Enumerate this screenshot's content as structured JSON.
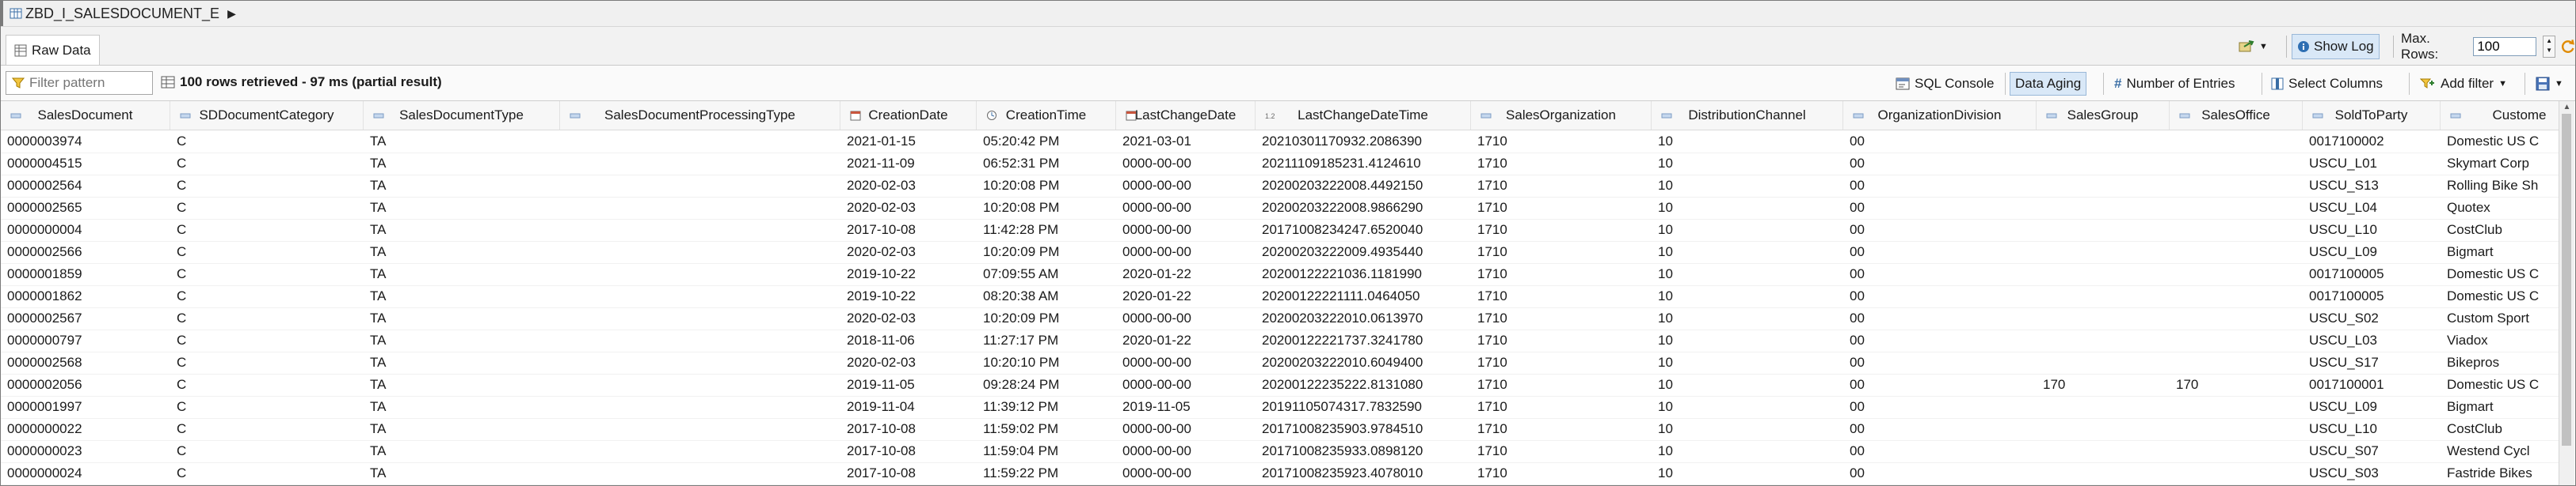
{
  "breadcrumb": {
    "label": "ZBD_I_SALESDOCUMENT_E"
  },
  "tabs": [
    {
      "label": "Raw Data"
    }
  ],
  "header_right": {
    "show_log_label": "Show Log",
    "max_rows_label": "Max. Rows:",
    "max_rows_value": "100"
  },
  "toolbar": {
    "filter_placeholder": "Filter pattern",
    "result_info": "100 rows retrieved - 97 ms (partial result)",
    "sql_console_label": "SQL Console",
    "data_aging_label": "Data Aging",
    "number_of_entries_label": "Number of Entries",
    "select_columns_label": "Select Columns",
    "add_filter_label": "Add filter"
  },
  "table": {
    "columns": [
      {
        "label": "SalesDocument",
        "type": "text"
      },
      {
        "label": "SDDocumentCategory",
        "type": "text"
      },
      {
        "label": "SalesDocumentType",
        "type": "text"
      },
      {
        "label": "SalesDocumentProcessingType",
        "type": "text"
      },
      {
        "label": "CreationDate",
        "type": "date"
      },
      {
        "label": "CreationTime",
        "type": "time"
      },
      {
        "label": "LastChangeDate",
        "type": "date"
      },
      {
        "label": "LastChangeDateTime",
        "type": "number"
      },
      {
        "label": "SalesOrganization",
        "type": "text"
      },
      {
        "label": "DistributionChannel",
        "type": "text"
      },
      {
        "label": "OrganizationDivision",
        "type": "text"
      },
      {
        "label": "SalesGroup",
        "type": "text"
      },
      {
        "label": "SalesOffice",
        "type": "text"
      },
      {
        "label": "SoldToParty",
        "type": "text"
      },
      {
        "label": "Custome",
        "type": "text"
      }
    ],
    "rows": [
      [
        "0000003974",
        "C",
        "TA",
        "",
        "2021-01-15",
        "05:20:42 PM",
        "2021-03-01",
        "20210301170932.2086390",
        "1710",
        "10",
        "00",
        "",
        "",
        "0017100002",
        "Domestic US C"
      ],
      [
        "0000004515",
        "C",
        "TA",
        "",
        "2021-11-09",
        "06:52:31 PM",
        "0000-00-00",
        "20211109185231.4124610",
        "1710",
        "10",
        "00",
        "",
        "",
        "USCU_L01",
        "Skymart Corp"
      ],
      [
        "0000002564",
        "C",
        "TA",
        "",
        "2020-02-03",
        "10:20:08 PM",
        "0000-00-00",
        "20200203222008.4492150",
        "1710",
        "10",
        "00",
        "",
        "",
        "USCU_S13",
        "Rolling Bike Sh"
      ],
      [
        "0000002565",
        "C",
        "TA",
        "",
        "2020-02-03",
        "10:20:08 PM",
        "0000-00-00",
        "20200203222008.9866290",
        "1710",
        "10",
        "00",
        "",
        "",
        "USCU_L04",
        "Quotex"
      ],
      [
        "0000000004",
        "C",
        "TA",
        "",
        "2017-10-08",
        "11:42:28 PM",
        "0000-00-00",
        "20171008234247.6520040",
        "1710",
        "10",
        "00",
        "",
        "",
        "USCU_L10",
        "CostClub"
      ],
      [
        "0000002566",
        "C",
        "TA",
        "",
        "2020-02-03",
        "10:20:09 PM",
        "0000-00-00",
        "20200203222009.4935440",
        "1710",
        "10",
        "00",
        "",
        "",
        "USCU_L09",
        "Bigmart"
      ],
      [
        "0000001859",
        "C",
        "TA",
        "",
        "2019-10-22",
        "07:09:55 AM",
        "2020-01-22",
        "20200122221036.1181990",
        "1710",
        "10",
        "00",
        "",
        "",
        "0017100005",
        "Domestic US C"
      ],
      [
        "0000001862",
        "C",
        "TA",
        "",
        "2019-10-22",
        "08:20:38 AM",
        "2020-01-22",
        "20200122221111.0464050",
        "1710",
        "10",
        "00",
        "",
        "",
        "0017100005",
        "Domestic US C"
      ],
      [
        "0000002567",
        "C",
        "TA",
        "",
        "2020-02-03",
        "10:20:09 PM",
        "0000-00-00",
        "20200203222010.0613970",
        "1710",
        "10",
        "00",
        "",
        "",
        "USCU_S02",
        "Custom Sport"
      ],
      [
        "0000000797",
        "C",
        "TA",
        "",
        "2018-11-06",
        "11:27:17 PM",
        "2020-01-22",
        "20200122221737.3241780",
        "1710",
        "10",
        "00",
        "",
        "",
        "USCU_L03",
        "Viadox"
      ],
      [
        "0000002568",
        "C",
        "TA",
        "",
        "2020-02-03",
        "10:20:10 PM",
        "0000-00-00",
        "20200203222010.6049400",
        "1710",
        "10",
        "00",
        "",
        "",
        "USCU_S17",
        "Bikepros"
      ],
      [
        "0000002056",
        "C",
        "TA",
        "",
        "2019-11-05",
        "09:28:24 PM",
        "0000-00-00",
        "20200122235222.8131080",
        "1710",
        "10",
        "00",
        "170",
        "170",
        "0017100001",
        "Domestic US C"
      ],
      [
        "0000001997",
        "C",
        "TA",
        "",
        "2019-11-04",
        "11:39:12 PM",
        "2019-11-05",
        "20191105074317.7832590",
        "1710",
        "10",
        "00",
        "",
        "",
        "USCU_L09",
        "Bigmart"
      ],
      [
        "0000000022",
        "C",
        "TA",
        "",
        "2017-10-08",
        "11:59:02 PM",
        "0000-00-00",
        "20171008235903.9784510",
        "1710",
        "10",
        "00",
        "",
        "",
        "USCU_L10",
        "CostClub"
      ],
      [
        "0000000023",
        "C",
        "TA",
        "",
        "2017-10-08",
        "11:59:04 PM",
        "0000-00-00",
        "20171008235933.0898120",
        "1710",
        "10",
        "00",
        "",
        "",
        "USCU_S07",
        "Westend Cycl"
      ],
      [
        "0000000024",
        "C",
        "TA",
        "",
        "2017-10-08",
        "11:59:22 PM",
        "0000-00-00",
        "20171008235923.4078010",
        "1710",
        "10",
        "00",
        "",
        "",
        "USCU_S03",
        "Fastride Bikes"
      ]
    ]
  }
}
